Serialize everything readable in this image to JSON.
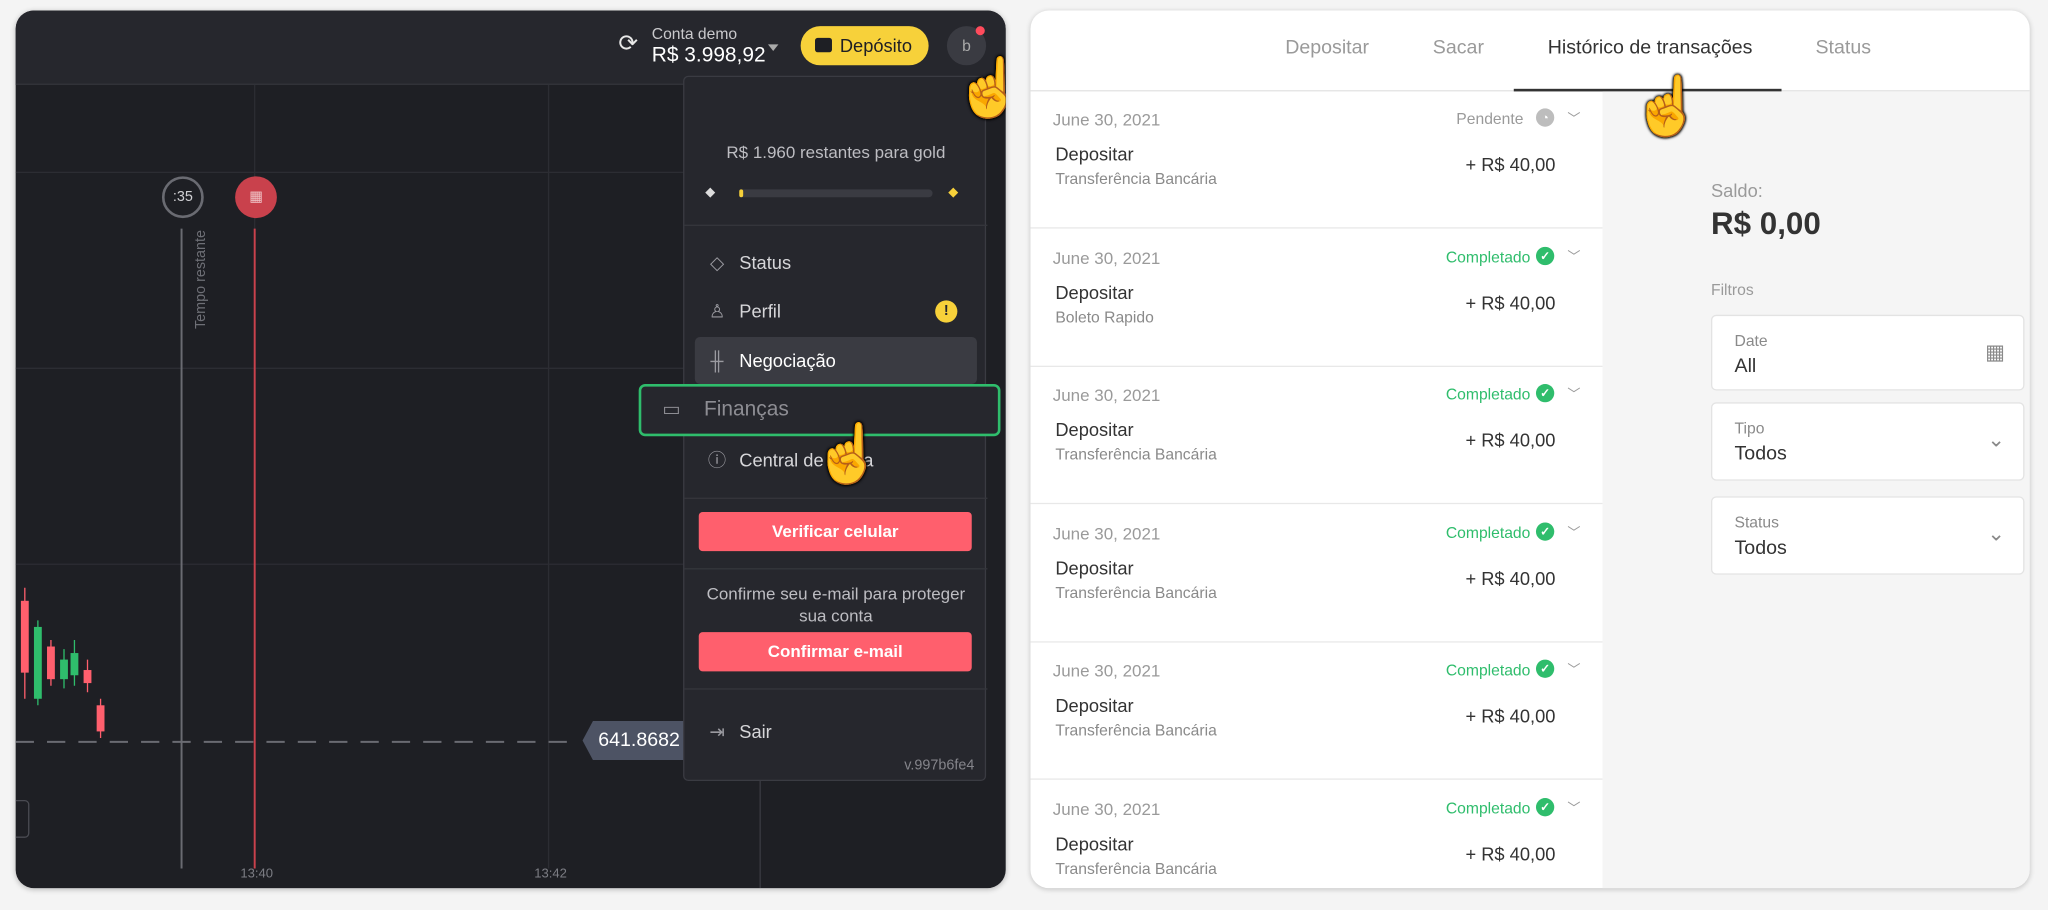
{
  "trading": {
    "account_label": "Conta demo",
    "account_balance": "R$ 3.998,92",
    "deposit_button": "Depósito",
    "avatar_initial": "b",
    "timer": ":35",
    "time_remaining_label": "Tempo restante",
    "price_tag": "641.8682",
    "time_ticks": [
      "13:40",
      "13:42"
    ],
    "icons": {
      "refresh": "refresh-icon",
      "wallet": "wallet-icon",
      "flag": "finish-flag-icon"
    }
  },
  "user_menu": {
    "gold_progress_text": "R$ 1.960 restantes para gold",
    "gold_progress": 0.02,
    "items": [
      {
        "label": "Status",
        "icon": "diamond-icon"
      },
      {
        "label": "Perfil",
        "icon": "user-icon",
        "badge": "!"
      },
      {
        "label": "Negociação",
        "icon": "trading-icon",
        "active": true
      },
      {
        "label": "Finanças",
        "icon": "wallet-icon",
        "highlighted": true
      },
      {
        "label": "Central de ajuda",
        "icon": "info-icon"
      }
    ],
    "verify_phone_button": "Verificar celular",
    "email_note": "Confirme seu e-mail para proteger sua conta",
    "confirm_email_button": "Confirmar e-mail",
    "logout_label": "Sair",
    "version": "v.997b6fe4"
  },
  "finance": {
    "tabs": [
      {
        "label": "Depositar",
        "active": false
      },
      {
        "label": "Sacar",
        "active": false
      },
      {
        "label": "Histórico de transações",
        "active": true
      },
      {
        "label": "Status",
        "active": false
      }
    ],
    "transactions": [
      {
        "date": "June 30, 2021",
        "status": "Pendente",
        "type": "Depositar",
        "method": "Transferência Bancária",
        "amount": "+ R$ 40,00"
      },
      {
        "date": "June 30, 2021",
        "status": "Completado",
        "type": "Depositar",
        "method": "Boleto Rapido",
        "amount": "+ R$ 40,00"
      },
      {
        "date": "June 30, 2021",
        "status": "Completado",
        "type": "Depositar",
        "method": "Transferência Bancária",
        "amount": "+ R$ 40,00"
      },
      {
        "date": "June 30, 2021",
        "status": "Completado",
        "type": "Depositar",
        "method": "Transferência Bancária",
        "amount": "+ R$ 40,00"
      },
      {
        "date": "June 30, 2021",
        "status": "Completado",
        "type": "Depositar",
        "method": "Transferência Bancária",
        "amount": "+ R$ 40,00"
      },
      {
        "date": "June 30, 2021",
        "status": "Completado",
        "type": "Depositar",
        "method": "Transferência Bancária",
        "amount": "+ R$ 40,00"
      }
    ],
    "balance_label": "Saldo:",
    "balance_value": "R$ 0,00",
    "filters_label": "Filtros",
    "filters": [
      {
        "label": "Date",
        "value": "All",
        "icon": "calendar-icon"
      },
      {
        "label": "Tipo",
        "value": "Todos",
        "icon": "chevron-down-icon"
      },
      {
        "label": "Status",
        "value": "Todos",
        "icon": "chevron-down-icon"
      }
    ]
  },
  "colors": {
    "accent_yellow": "#f7d13a",
    "complete_green": "#2fbd6c",
    "pending_gray": "#9a9a9a",
    "action_red": "#ff5f6d",
    "highlight_border": "#2fbd6c"
  }
}
